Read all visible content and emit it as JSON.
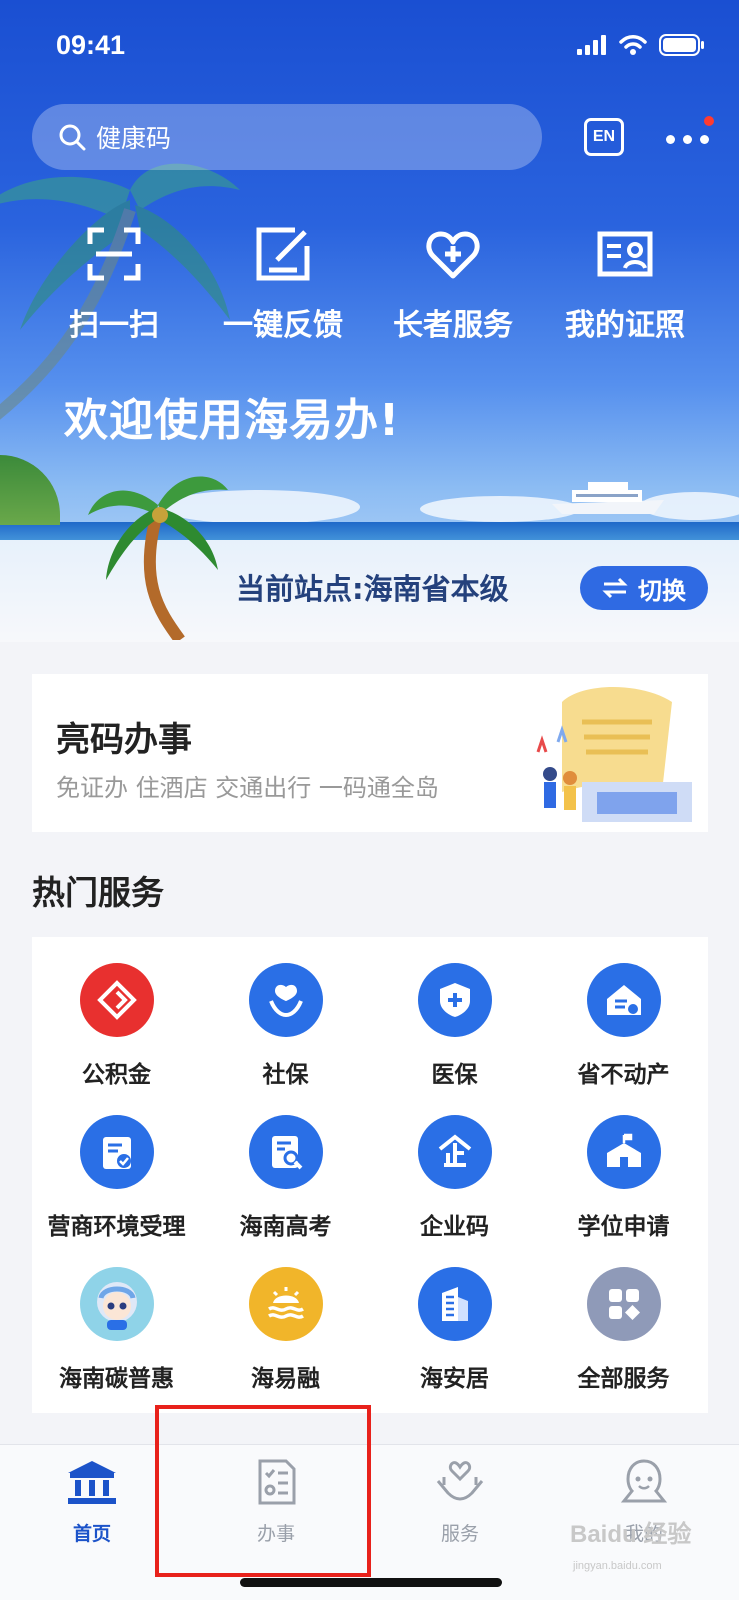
{
  "status_bar": {
    "time": "09:41"
  },
  "search": {
    "placeholder": "健康码",
    "icon": "search-icon"
  },
  "header": {
    "lang_label": "EN"
  },
  "quick_actions": [
    {
      "label": "扫一扫",
      "icon": "scan-icon"
    },
    {
      "label": "一键反馈",
      "icon": "feedback-icon"
    },
    {
      "label": "长者服务",
      "icon": "heart-plus-icon"
    },
    {
      "label": "我的证照",
      "icon": "id-card-icon"
    }
  ],
  "hero": {
    "welcome": "欢迎使用海易办!",
    "site_label": "当前站点:海南省本级",
    "switch_label": "切换"
  },
  "card": {
    "title": "亮码办事",
    "subtitle": "免证办 住酒店 交通出行 一码通全岛"
  },
  "hot_services": {
    "title": "热门服务",
    "items": [
      {
        "label": "公积金",
        "icon": "fund-icon",
        "color": "#e8302f"
      },
      {
        "label": "社保",
        "icon": "social-security-icon",
        "color": "#2a6fe6"
      },
      {
        "label": "医保",
        "icon": "medical-insurance-icon",
        "color": "#2a6fe6"
      },
      {
        "label": "省不动产",
        "icon": "property-icon",
        "color": "#2a6fe6"
      },
      {
        "label": "营商环境受理",
        "icon": "business-icon",
        "color": "#2a6fe6"
      },
      {
        "label": "海南高考",
        "icon": "exam-icon",
        "color": "#2a6fe6"
      },
      {
        "label": "企业码",
        "icon": "enterprise-code-icon",
        "color": "#2a6fe6"
      },
      {
        "label": "学位申请",
        "icon": "school-icon",
        "color": "#2a6fe6"
      },
      {
        "label": "海南碳普惠",
        "icon": "carbon-avatar-icon",
        "color": "#8fd3e8"
      },
      {
        "label": "海易融",
        "icon": "finance-icon",
        "color": "#f1b52a"
      },
      {
        "label": "海安居",
        "icon": "housing-icon",
        "color": "#2a6fe6"
      },
      {
        "label": "全部服务",
        "icon": "all-services-icon",
        "color": "#8f9ab8"
      }
    ]
  },
  "tabbar": {
    "items": [
      {
        "label": "首页",
        "icon": "home-icon",
        "active": true
      },
      {
        "label": "办事",
        "icon": "tasks-icon",
        "active": false
      },
      {
        "label": "服务",
        "icon": "service-icon",
        "active": false
      },
      {
        "label": "我的",
        "icon": "profile-icon",
        "active": false
      }
    ]
  },
  "watermark": {
    "text": "Baidu 经验",
    "sub": "jingyan.baidu.com"
  }
}
